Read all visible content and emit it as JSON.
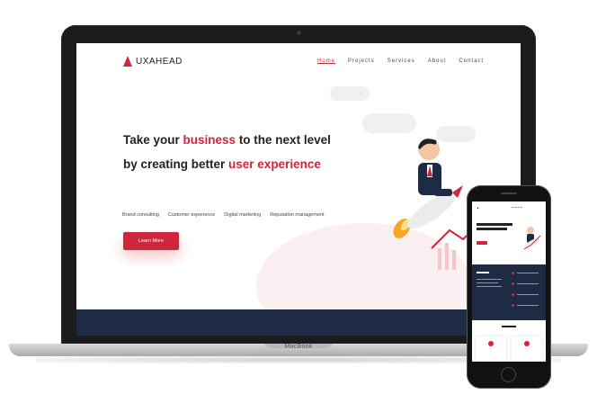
{
  "device": {
    "laptop_label": "MacBook"
  },
  "site": {
    "logo": "UXAHEAD",
    "nav": [
      "Home",
      "Projects",
      "Services",
      "About",
      "Contact"
    ],
    "hero_line1_a": "Take your ",
    "hero_line1_accent": "business",
    "hero_line1_b": " to the next level",
    "hero_line2_a": "by creating better ",
    "hero_line2_accent": "user experience",
    "services": [
      "Brand consulting",
      "Customer experience",
      "Digital marketing",
      "Reputation management"
    ],
    "cta": "Learn More"
  },
  "colors": {
    "accent": "#d0263c",
    "navy": "#1e2b45"
  },
  "icons": [
    "rocket-icon",
    "logo-triangle-icon",
    "growth-arrow-icon"
  ]
}
